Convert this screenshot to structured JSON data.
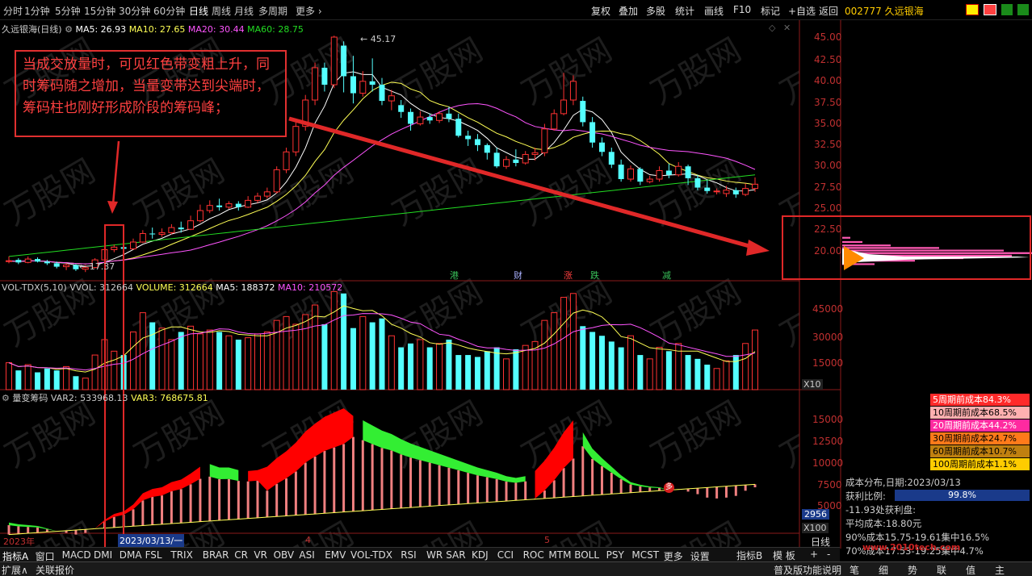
{
  "topbar": {
    "periods": [
      "分时",
      "1分钟",
      "5分钟",
      "15分钟",
      "30分钟",
      "60分钟",
      "日线",
      "周线",
      "月线",
      "多周期",
      "更多"
    ],
    "tools": [
      "复权",
      "叠加",
      "多股",
      "统计",
      "画线",
      "F10",
      "标记",
      "+自选",
      "返回"
    ],
    "stock_title": "002777 久远银海"
  },
  "kline": {
    "name": "久远银海(日线)",
    "ma5": "MA5: 26.93",
    "ma10": "MA10: 27.65",
    "ma20": "MA20: 30.44",
    "ma60": "MA60: 28.75",
    "high_label": "45.17",
    "low_label": "17.37",
    "y_ticks": [
      "45.00",
      "42.50",
      "40.00",
      "37.50",
      "35.00",
      "32.50",
      "30.00",
      "27.50",
      "25.00",
      "22.50",
      "20.00"
    ],
    "markers": [
      "港",
      "财",
      "涨",
      "跌",
      "减"
    ],
    "colors": {
      "up": "#ff3232",
      "down": "#54ffff",
      "ma5": "#ffffff",
      "ma10": "#ffff55",
      "ma20": "#ff55ff",
      "ma60": "#22dd22"
    }
  },
  "annotation": {
    "text": "当成交放量时，可见红色带变粗上升，同时筹码随之增加，当量变带达到尖端时，筹码柱也刚好形成阶段的筹码峰；"
  },
  "volume": {
    "name": "VOL-TDX(5,10)",
    "vvol": "VVOL: 312664",
    "volume": "VOLUME: 312664",
    "ma5": "MA5: 188372",
    "ma10": "MA10: 210572",
    "y_ticks": [
      "45000",
      "30000",
      "15000"
    ],
    "unit": "X10"
  },
  "chip_ind": {
    "name": "量变筹码",
    "var2": "VAR2: 533968.13",
    "var3": "VAR3: 768675.81",
    "y_ticks": [
      "15000",
      "12500",
      "10000",
      "7500",
      "5000"
    ],
    "current_value": "2956",
    "unit": "X100",
    "duo": "多"
  },
  "xaxis": {
    "year": "2023年",
    "date_box": "2023/03/13/一",
    "month4": "4",
    "month5": "5",
    "period_label": "日线"
  },
  "cost_legend": [
    {
      "label": "5周期前成本84.3%",
      "bg": "#ff2a2a",
      "fg": "#ffffff"
    },
    {
      "label": "10周期前成本68.5%",
      "bg": "#ffb0b0",
      "fg": "#000000"
    },
    {
      "label": "20周期前成本44.2%",
      "bg": "#ff2aa0",
      "fg": "#ffffff"
    },
    {
      "label": "30周期前成本24.7%",
      "bg": "#ff7a1a",
      "fg": "#000000"
    },
    {
      "label": "60周期前成本10.7%",
      "bg": "#c08010",
      "fg": "#000000"
    },
    {
      "label": "100周期前成本1.1%",
      "bg": "#ffcc00",
      "fg": "#000000"
    }
  ],
  "cost_info": {
    "date_label": "成本分布,日期:",
    "date": "2023/03/13",
    "profit_label": "获利比例:",
    "profit": "99.8%",
    "pan_label": "-11.93处获利盘:",
    "avg_label": "平均成本:",
    "avg": "18.80元",
    "c90": "90%成本15.75-19.61集中16.5%",
    "c70": "70%成本17.53-19.25集中4.7%"
  },
  "bottom_tabs": [
    "指标A",
    "窗口",
    "MACD",
    "DMI",
    "DMA",
    "FSL",
    "TRIX",
    "BRAR",
    "CR",
    "VR",
    "OBV",
    "ASI",
    "EMV",
    "VOL-TDX",
    "RSI",
    "WR",
    "SAR",
    "KDJ",
    "CCI",
    "ROC",
    "MTM",
    "BOLL",
    "PSY",
    "MCST",
    "更多",
    "设置"
  ],
  "bottom_right": [
    "指标B",
    "模 板",
    "+",
    "-"
  ],
  "status": {
    "expand": "扩展∧",
    "related": "关联报价",
    "version": "普及版功能说明"
  },
  "right_tabs": [
    "笔",
    "细",
    "势",
    "联",
    "值",
    "主"
  ],
  "watermark": "www.2010tech.com"
}
